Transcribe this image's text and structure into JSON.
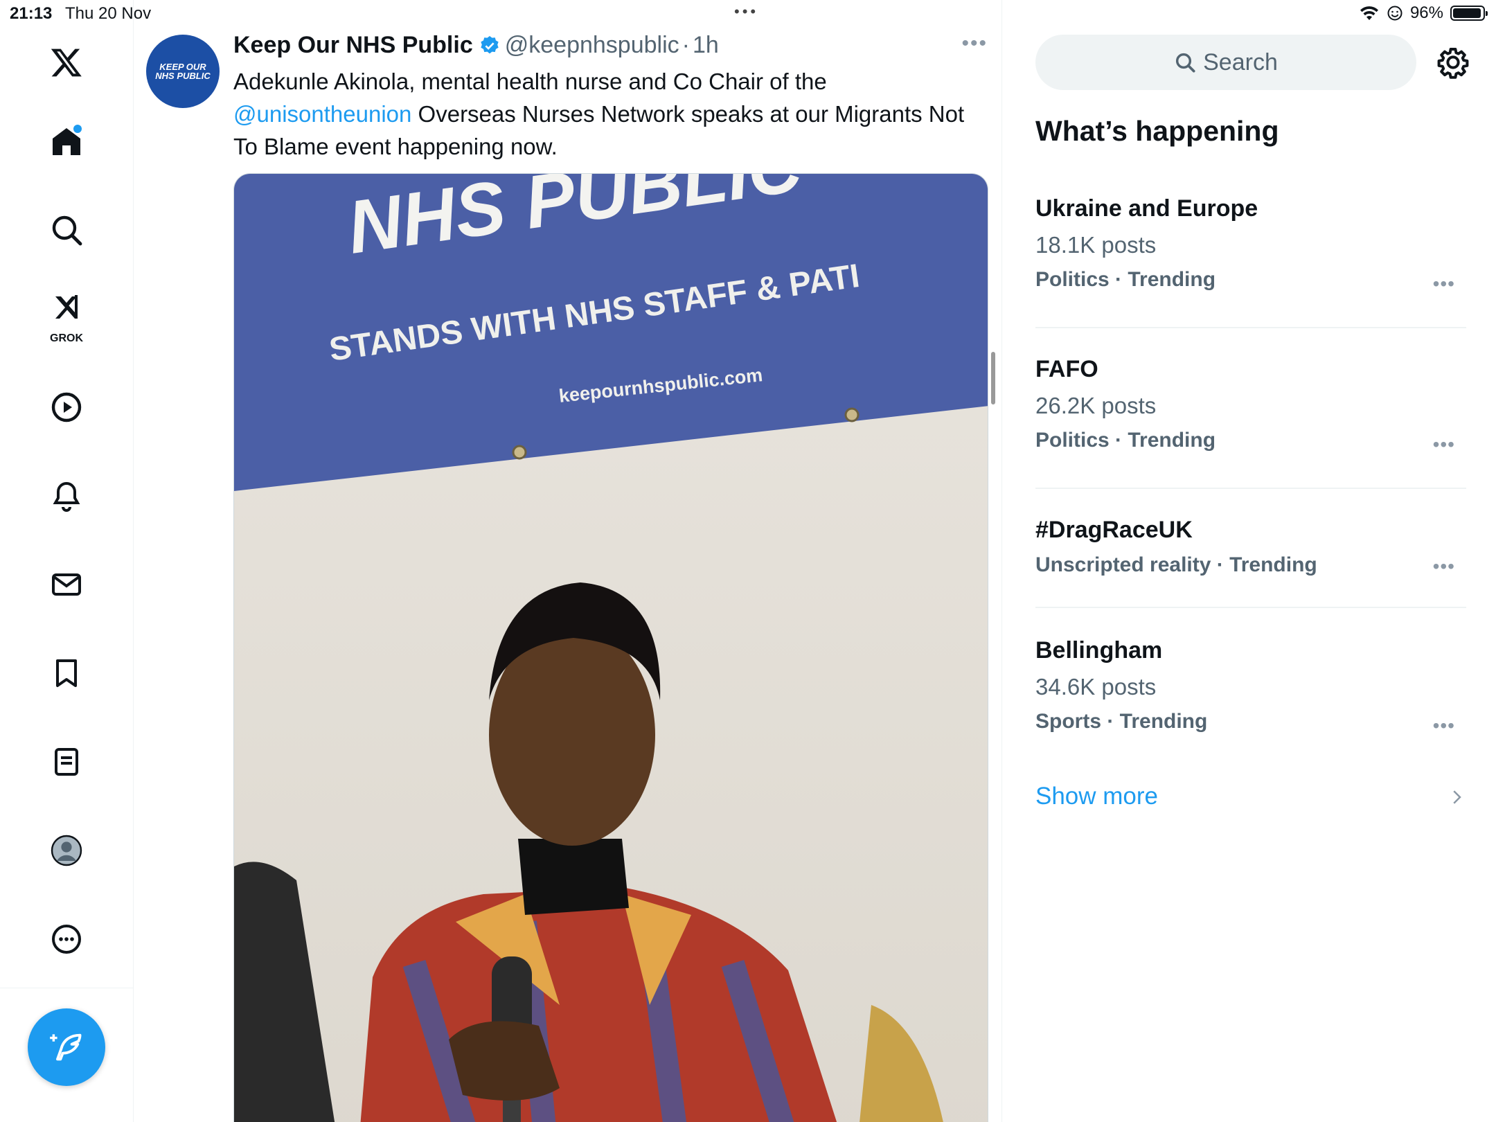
{
  "status_bar": {
    "time": "21:13",
    "date": "Thu 20 Nov",
    "battery": "96%",
    "battery_level": 0.96
  },
  "nav": {
    "grok_label": "GROK",
    "items": [
      "x-logo",
      "home-icon",
      "search-icon",
      "grok-icon",
      "video-icon",
      "notifications-icon",
      "messages-icon",
      "bookmarks-icon",
      "lists-icon",
      "profile-icon",
      "more-icon"
    ]
  },
  "tweet": {
    "avatar_line1": "KEEP OUR",
    "avatar_line2": "NHS PUBLIC",
    "author_name": "Keep Our NHS Public",
    "handle": "@keepnhspublic",
    "separator": "·",
    "time": "1h",
    "text_part1": "Adekunle Akinola, mental health nurse and Co Chair of the ",
    "mention": "@unisontheunion",
    "text_part2": " Overseas Nurses Network speaks at our Migrants Not To Blame event happening now."
  },
  "media": {
    "banner_title": "NHS PUBLIC",
    "banner_subtitle": "STANDS WITH NHS STAFF & PATI",
    "banner_url": "keepournhspublic.com"
  },
  "sidebar": {
    "search_placeholder": "Search",
    "section_title": "What’s happening",
    "trends": [
      {
        "topic": "Ukraine and Europe",
        "count": "18.1K posts",
        "category": "Politics · Trending"
      },
      {
        "topic": "FAFO",
        "count": "26.2K posts",
        "category": "Politics · Trending"
      },
      {
        "topic": "#DragRaceUK",
        "count": "",
        "category": "Unscripted reality · Trending"
      },
      {
        "topic": "Bellingham",
        "count": "34.6K posts",
        "category": "Sports · Trending"
      }
    ],
    "show_more": "Show more"
  },
  "colors": {
    "accent": "#1d9bf0",
    "text": "#0f1419",
    "muted": "#536471",
    "banner_blue": "#4a5fa8"
  }
}
